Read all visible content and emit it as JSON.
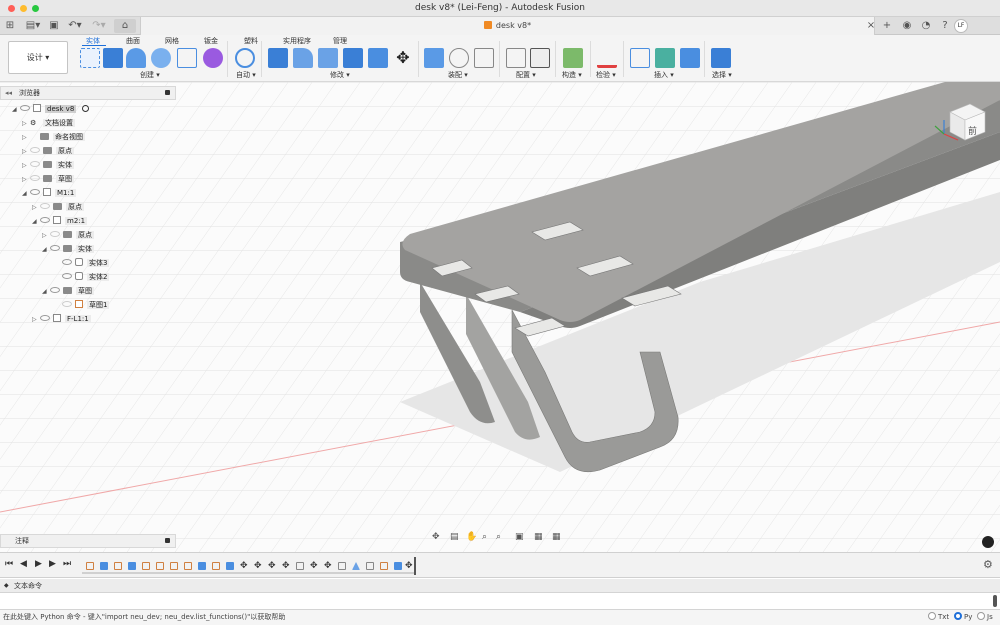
{
  "window": {
    "title": "desk v8* (Lei-Feng) - Autodesk Fusion"
  },
  "tabbar": {
    "doc_tab": "desk v8*",
    "user_initials": "LF"
  },
  "ribbon": {
    "workspace": "设计 ▾",
    "tabs": [
      "实体",
      "曲面",
      "网格",
      "钣金",
      "塑料",
      "实用程序",
      "管理"
    ],
    "groups": [
      "创建 ▾",
      "自动 ▾",
      "修改 ▾",
      "装配 ▾",
      "配置 ▾",
      "构造 ▾",
      "检验 ▾",
      "插入 ▾",
      "选择 ▾"
    ]
  },
  "browser": {
    "header": "浏览器",
    "root": "desk v8",
    "items": [
      "文档设置",
      "命名视图",
      "原点",
      "实体",
      "草图",
      "M1:1",
      "原点",
      "m2:1",
      "原点",
      "实体",
      "实体3",
      "实体2",
      "草图",
      "草图1",
      "F-L1:1"
    ]
  },
  "notes": {
    "label": "注释"
  },
  "textcommands": {
    "label": "文本命令"
  },
  "status": {
    "hint": "在此处键入 Python 命令 - 键入\"import neu_dev; neu_dev.list_functions()\"以获取帮助",
    "modes": [
      "Txt",
      "Py",
      "Js"
    ],
    "selected_mode": "Py"
  },
  "viewcube": {
    "label": "前"
  },
  "colors": {
    "accent": "#1e6fd9",
    "model_gray": "#9a9a98",
    "grid": "#e0e0e0",
    "axis_red": "#e88"
  }
}
